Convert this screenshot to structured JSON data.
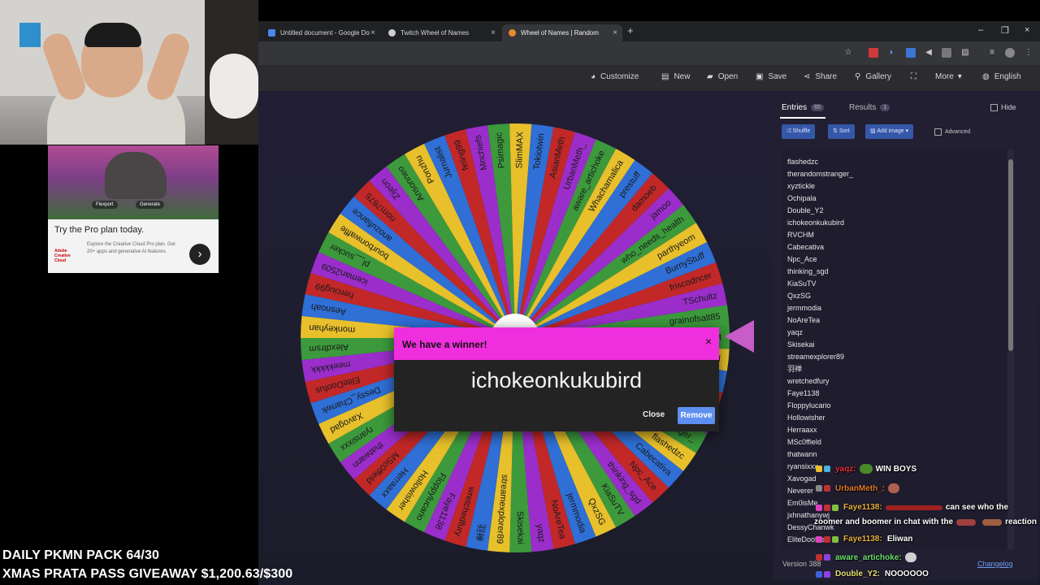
{
  "browser": {
    "tabs": [
      {
        "label": "Untitled document - Google Do",
        "favicon_color": "#4f86ec",
        "active": false
      },
      {
        "label": "Twitch Wheel of Names",
        "favicon_color": "#cfcfcf",
        "active": false
      },
      {
        "label": "Wheel of Names | Random",
        "favicon_color": "#ea8a2a",
        "active": true
      }
    ],
    "tab_close_glyph": "×",
    "new_tab_glyph": "+",
    "window_controls": [
      "–",
      "❐",
      "×"
    ]
  },
  "ad": {
    "title": "Try the Pro plan today.",
    "brand": "Adobe Creative Cloud",
    "description": "Explore the Creative Cloud Pro plan. Get 20+ apps and generative AI features.",
    "pills": [
      "Flexport",
      "Generate"
    ],
    "next_glyph": "›"
  },
  "nav": {
    "items": [
      {
        "label": "Customize",
        "icon": "palette-icon",
        "glyph": "◕"
      },
      {
        "label": "New",
        "icon": "new-file-icon",
        "glyph": "▤"
      },
      {
        "label": "Open",
        "icon": "folder-icon",
        "glyph": "▰"
      },
      {
        "label": "Save",
        "icon": "save-icon",
        "glyph": "▣"
      },
      {
        "label": "Share",
        "icon": "share-icon",
        "glyph": "⋖"
      },
      {
        "label": "Gallery",
        "icon": "search-icon",
        "glyph": "⚲"
      },
      {
        "label": "",
        "icon": "fullscreen-icon",
        "glyph": "⛶"
      },
      {
        "label": "More",
        "icon": "chevron-down-icon",
        "glyph": "▾"
      },
      {
        "label": "English",
        "icon": "globe-icon",
        "glyph": "◍"
      }
    ]
  },
  "wheel": {
    "colors": [
      "#3c9a3c",
      "#e7c02b",
      "#2f6fd6",
      "#c22828",
      "#9b2ecb"
    ],
    "visible_names": [
      "RVCHM",
      "ichokeonkukubird",
      "Double_Y2",
      "Ochipala",
      "xyztickle",
      "therandomstranger_",
      "flashedzc",
      "Cabecativa",
      "Npc_Ace",
      "thinking_sgd",
      "KiaSuTV",
      "QxzSG",
      "jermmodia",
      "NoAreTea",
      "yaqz",
      "Skisekai",
      "streamexplorer89",
      "羽禅",
      "wretchedfury",
      "Faye1138",
      "Floppylucario",
      "Hollowisher",
      "Herraaxx",
      "MSc0ffield",
      "thatwann",
      "ryansixxx",
      "Xavogad",
      "Dessy_Chanwk",
      "EliteDoofus",
      "meekkkkk",
      "Alexdtrsm",
      "monkeyhan",
      "Aesnoah",
      "herciug99",
      "iceman2509",
      "pl__sucker",
      "bourbonwaffle",
      "anozufiance",
      "norn7675",
      "Zijeon",
      "Ansonneo",
      "Ponzhu",
      "Jurnalist",
      "feiing99",
      "Mnchiefs",
      "Psimagic",
      "SlimMAX",
      "Tokiotwin",
      "AsianMeth",
      "UrbanMeth_",
      "aware_artichoke",
      "Whachamalica",
      "prestuff",
      "damoeb",
      "jamoo",
      "who_needs_health",
      "parthyeom",
      "BurnyStuff",
      "friscodncer",
      "TSchultz",
      "grainofsalt85"
    ],
    "pointer_color": "#c85cc8"
  },
  "winner_modal": {
    "title": "We have a winner!",
    "close_glyph": "×",
    "winner": "ichokeonkukubird",
    "close_label": "Close",
    "remove_label": "Remove"
  },
  "panel": {
    "tabs": [
      {
        "label": "Entries",
        "count": "65"
      },
      {
        "label": "Results",
        "count": "1"
      }
    ],
    "hide_label": "Hide",
    "buttons": {
      "shuffle": "Shuffle",
      "sort": "Sort",
      "add_image": "Add image"
    },
    "advanced_label": "Advanced",
    "entries": [
      "flashedzc",
      "therandomstranger_",
      "xyztickle",
      "Ochipala",
      "Double_Y2",
      "ichokeonkukubird",
      "RVCHM",
      "Cabecativa",
      "Npc_Ace",
      "thinking_sgd",
      "KiaSuTV",
      "QxzSG",
      "jermmodia",
      "NoAreTea",
      "yaqz",
      "Skisekai",
      "streamexplorer89",
      "羽禅",
      "wretchedfury",
      "Faye1138",
      "Floppylucario",
      "Hollowisher",
      "Herraaxx",
      "MSc0ffield",
      "thatwann",
      "ryansixxx",
      "Xavogad",
      "Neverer",
      "Em0isMe",
      "jxhnathanywj",
      "DessyChanwk",
      "EliteDoofus"
    ],
    "version": "Version 388",
    "changelog": "Changelog"
  },
  "chat": [
    {
      "user": "yaqz:",
      "user_color": "#e0303c",
      "message": "WIN BOYS",
      "emote_before": "#4a8a2a"
    },
    {
      "user": "UrbanMeth_:",
      "user_color": "#e07a2a",
      "message": "",
      "emote_after": "#b06050"
    },
    {
      "user": "Faye1138:",
      "user_color": "#e8b040",
      "message": "can see who the"
    },
    {
      "user": "",
      "user_color": "#ffffff",
      "message": "zoomer and boomer in chat with the"
    },
    {
      "user": "",
      "user_color": "#ffffff",
      "message": "reaction"
    },
    {
      "user": "Faye1138:",
      "user_color": "#e8b040",
      "message": "Eliwan"
    },
    {
      "user": "aware_artichoke:",
      "user_color": "#70e070",
      "message": ""
    },
    {
      "user": "Double_Y2:",
      "user_color": "#e8e070",
      "message": "NOOOOOO"
    }
  ],
  "stream": {
    "line1": "DAILY PKMN PACK 64/30",
    "line2": "XMAS PRATA PASS GIVEAWAY $1,200.63/$300"
  }
}
